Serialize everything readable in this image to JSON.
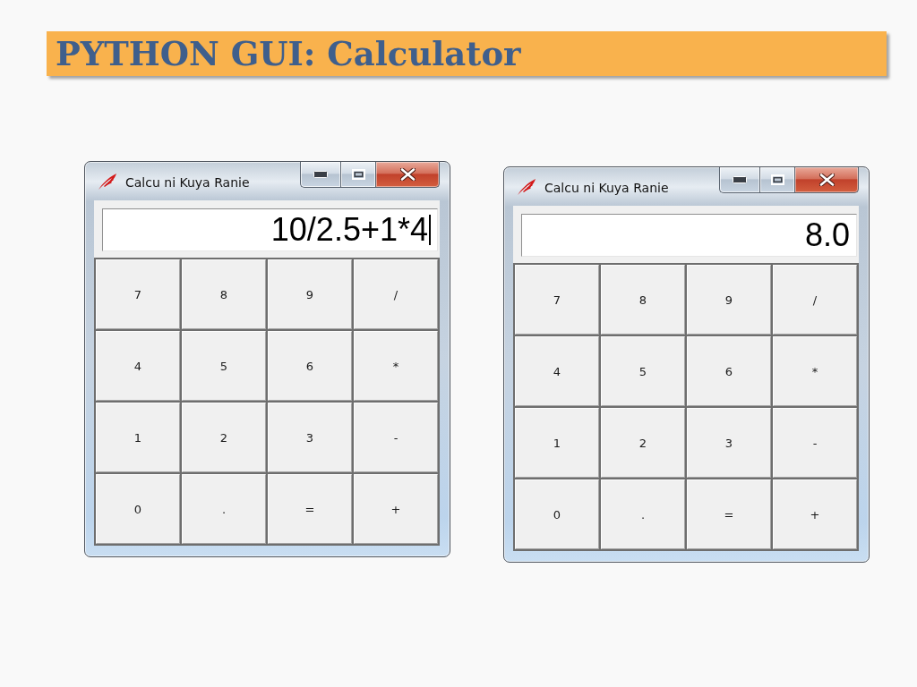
{
  "slide": {
    "title": "PYTHON GUI: Calculator"
  },
  "windows": [
    {
      "title": "Calcu ni Kuya Ranie",
      "display": {
        "value": "10/2.5+1*4",
        "focused": true
      },
      "keys": [
        "7",
        "8",
        "9",
        "/",
        "4",
        "5",
        "6",
        "*",
        "1",
        "2",
        "3",
        "-",
        "0",
        ".",
        "=",
        "+"
      ]
    },
    {
      "title": "Calcu ni Kuya Ranie",
      "display": {
        "value": "8.0",
        "focused": false
      },
      "keys": [
        "7",
        "8",
        "9",
        "/",
        "4",
        "5",
        "6",
        "*",
        "1",
        "2",
        "3",
        "-",
        "0",
        ".",
        "=",
        "+"
      ]
    }
  ]
}
